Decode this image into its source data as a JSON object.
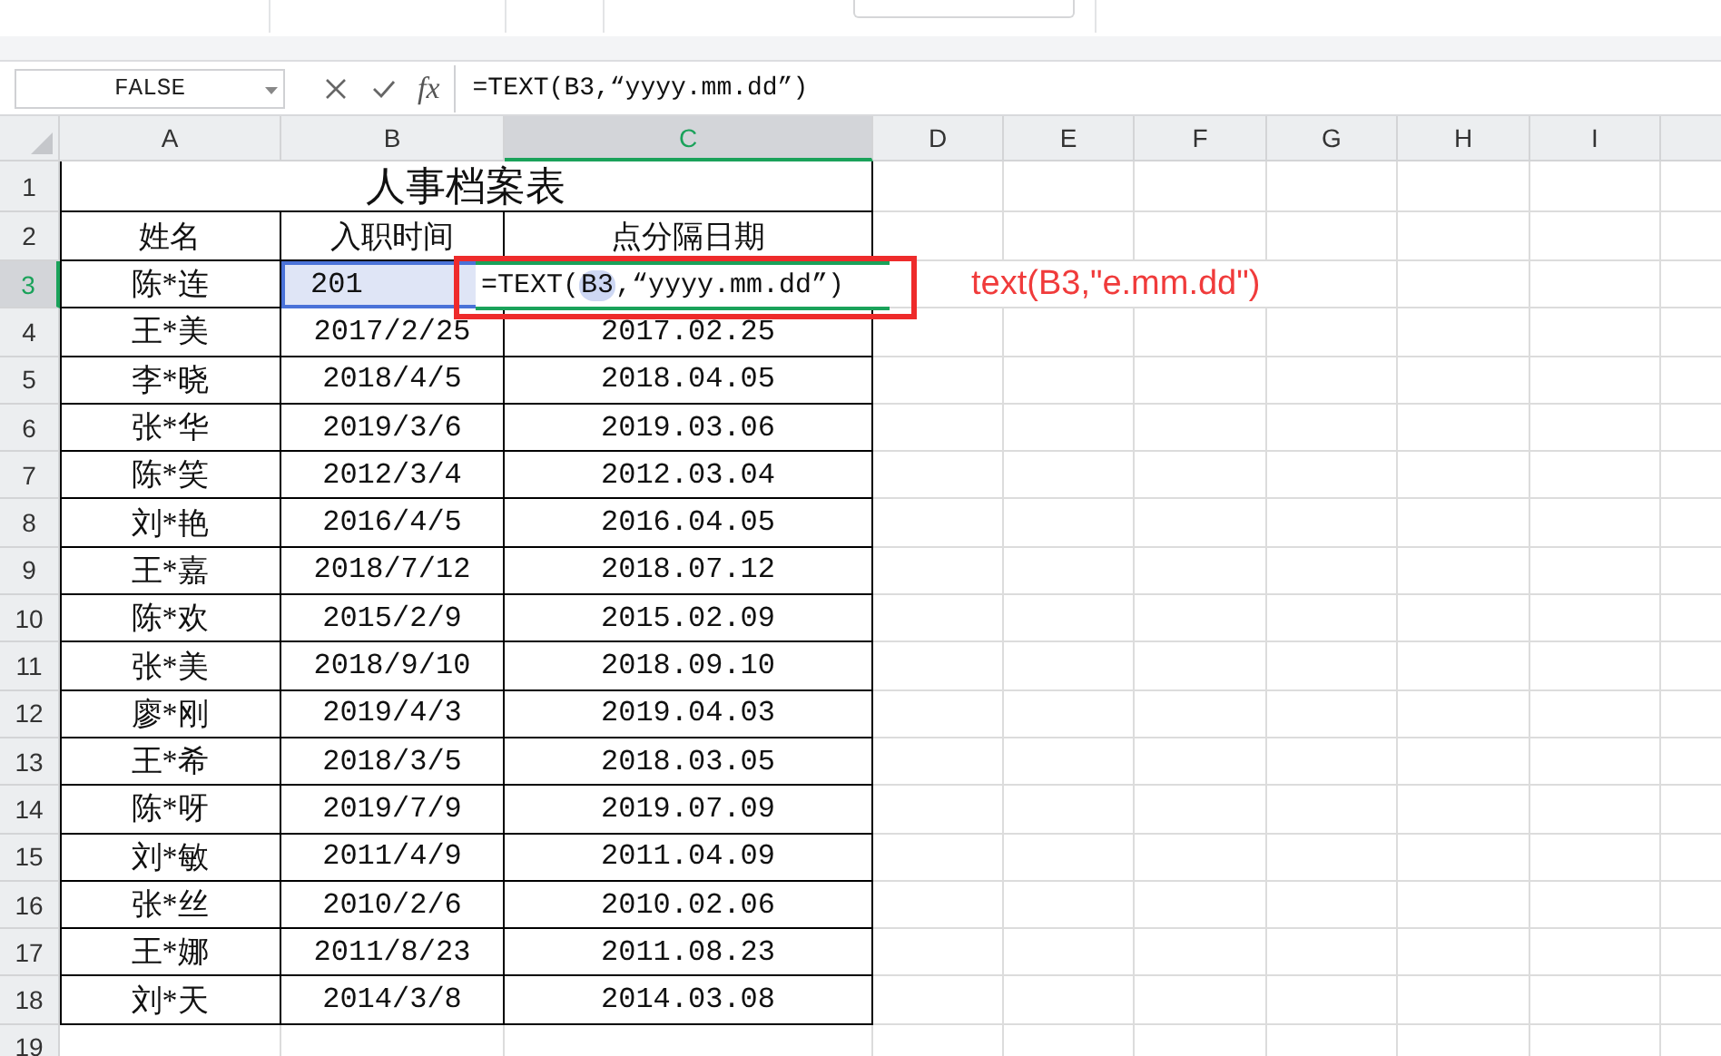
{
  "formula_bar": {
    "name_box": "FALSE",
    "fx": "fx",
    "formula": "=TEXT(B3,“yyyy.mm.dd”)"
  },
  "column_headers": [
    {
      "label": "A",
      "selected": false
    },
    {
      "label": "B",
      "selected": false
    },
    {
      "label": "C",
      "selected": true
    },
    {
      "label": "D",
      "selected": false
    },
    {
      "label": "E",
      "selected": false
    },
    {
      "label": "F",
      "selected": false
    },
    {
      "label": "G",
      "selected": false
    },
    {
      "label": "H",
      "selected": false
    },
    {
      "label": "I",
      "selected": false
    }
  ],
  "row_headers": [
    {
      "label": "1",
      "selected": false
    },
    {
      "label": "2",
      "selected": false
    },
    {
      "label": "3",
      "selected": true
    },
    {
      "label": "4",
      "selected": false
    },
    {
      "label": "5",
      "selected": false
    },
    {
      "label": "6",
      "selected": false
    },
    {
      "label": "7",
      "selected": false
    },
    {
      "label": "8",
      "selected": false
    },
    {
      "label": "9",
      "selected": false
    },
    {
      "label": "10",
      "selected": false
    },
    {
      "label": "11",
      "selected": false
    },
    {
      "label": "12",
      "selected": false
    },
    {
      "label": "13",
      "selected": false
    },
    {
      "label": "14",
      "selected": false
    },
    {
      "label": "15",
      "selected": false
    },
    {
      "label": "16",
      "selected": false
    },
    {
      "label": "17",
      "selected": false
    },
    {
      "label": "18",
      "selected": false
    },
    {
      "label": "19",
      "selected": false
    }
  ],
  "sheet": {
    "title": "人事档案表",
    "headers": [
      "姓名",
      "入职时间",
      "点分隔日期"
    ],
    "rows": [
      {
        "name": "陈*连",
        "hire_date": "201",
        "referenced": true
      },
      {
        "name": "王*美",
        "hire_date": "2017/2/25",
        "formatted": "2017.02.25",
        "referenced": false
      },
      {
        "name": "李*晓",
        "hire_date": "2018/4/5",
        "formatted": "2018.04.05",
        "referenced": false
      },
      {
        "name": "张*华",
        "hire_date": "2019/3/6",
        "formatted": "2019.03.06",
        "referenced": false
      },
      {
        "name": "陈*笑",
        "hire_date": "2012/3/4",
        "formatted": "2012.03.04",
        "referenced": false
      },
      {
        "name": "刘*艳",
        "hire_date": "2016/4/5",
        "formatted": "2016.04.05",
        "referenced": false
      },
      {
        "name": "王*嘉",
        "hire_date": "2018/7/12",
        "formatted": "2018.07.12",
        "referenced": false
      },
      {
        "name": "陈*欢",
        "hire_date": "2015/2/9",
        "formatted": "2015.02.09",
        "referenced": false
      },
      {
        "name": "张*美",
        "hire_date": "2018/9/10",
        "formatted": "2018.09.10",
        "referenced": false
      },
      {
        "name": "廖*刚",
        "hire_date": "2019/4/3",
        "formatted": "2019.04.03",
        "referenced": false
      },
      {
        "name": "王*希",
        "hire_date": "2018/3/5",
        "formatted": "2018.03.05",
        "referenced": false
      },
      {
        "name": "陈*呀",
        "hire_date": "2019/7/9",
        "formatted": "2019.07.09",
        "referenced": false
      },
      {
        "name": "刘*敏",
        "hire_date": "2011/4/9",
        "formatted": "2011.04.09",
        "referenced": false
      },
      {
        "name": "张*丝",
        "hire_date": "2010/2/6",
        "formatted": "2010.02.06",
        "referenced": false
      },
      {
        "name": "王*娜",
        "hire_date": "2011/8/23",
        "formatted": "2011.08.23",
        "referenced": false
      },
      {
        "name": "刘*天",
        "hire_date": "2014/3/8",
        "formatted": "2014.03.08",
        "referenced": false
      }
    ]
  },
  "editor": {
    "before": "=TEXT(",
    "reference": "B3",
    "after": ",“yyyy.mm.dd”)"
  },
  "annotation": "text(B3,\"e.mm.dd\")"
}
